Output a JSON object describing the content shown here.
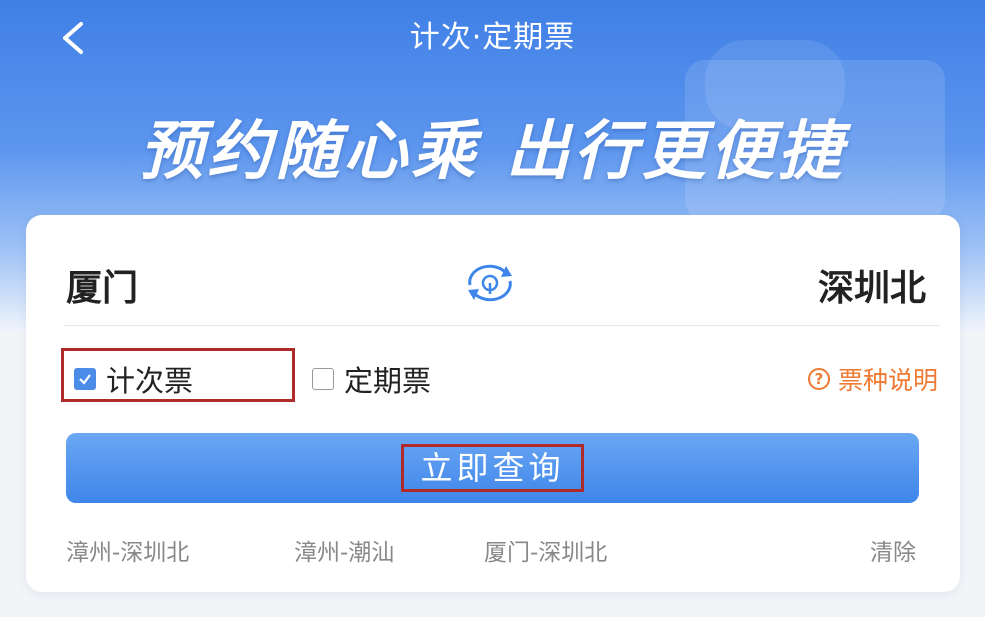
{
  "header": {
    "title": "计次·定期票",
    "slogan": "预约随心乘 出行更便捷"
  },
  "route": {
    "from": "厦门",
    "to": "深圳北"
  },
  "ticket_types": {
    "count_label": "计次票",
    "count_checked": true,
    "period_label": "定期票",
    "period_checked": false,
    "help_label": "票种说明"
  },
  "query_button": "立即查询",
  "history": {
    "items": [
      "漳州-深圳北",
      "漳州-潮汕",
      "厦门-深圳北"
    ],
    "clear_label": "清除"
  },
  "colors": {
    "accent": "#3f86ea",
    "help": "#ee7a33",
    "highlight_box": "#b02a2a"
  }
}
